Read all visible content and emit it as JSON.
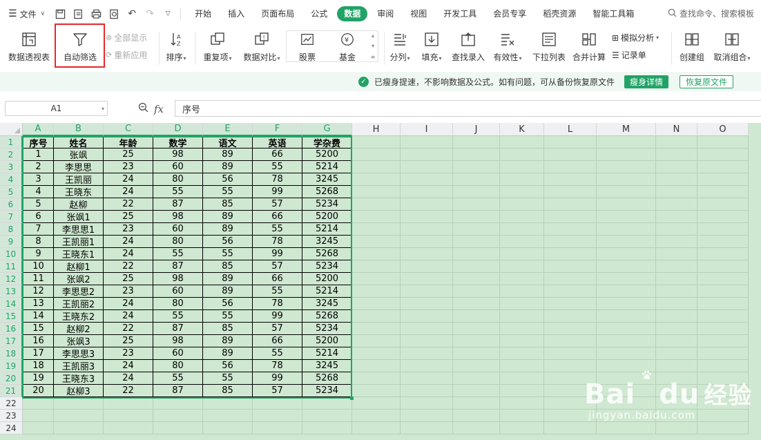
{
  "menubar": {
    "file_label": "文件",
    "tabs": [
      "开始",
      "插入",
      "页面布局",
      "公式",
      "数据",
      "审阅",
      "视图",
      "开发工具",
      "会员专享",
      "稻壳资源",
      "智能工具箱"
    ],
    "active_tab": "数据",
    "search_placeholder": "查找命令、搜索模板"
  },
  "ribbon": {
    "pivot": "数据透视表",
    "autofilter": "自动筛选",
    "show_all": "全部显示",
    "reapply": "重新应用",
    "sort": "排序",
    "duplicates": "重复项",
    "compare": "数据对比",
    "stocks": "股票",
    "funds": "基金",
    "split": "分列",
    "fill": "填充",
    "lookup_entry": "查找录入",
    "validity": "有效性",
    "dropdown_list": "下拉列表",
    "consolidate": "合并计算",
    "what_if": "模拟分析",
    "record_form": "记录单",
    "create_group": "创建组",
    "ungroup": "取消组合"
  },
  "notice": {
    "text": "已瘦身提速，不影响数据及公式。如有问题，可从备份恢复原文件",
    "details_button": "瘦身详情",
    "restore_button": "恢复原文件"
  },
  "formula_bar": {
    "cell_ref": "A1",
    "content": "序号"
  },
  "sheet": {
    "columns": [
      "A",
      "B",
      "C",
      "D",
      "E",
      "F",
      "G",
      "H",
      "I",
      "J",
      "K",
      "L",
      "M",
      "N",
      "O"
    ],
    "rows": [
      "1",
      "2",
      "3",
      "4",
      "5",
      "6",
      "7",
      "8",
      "9",
      "10",
      "11",
      "12",
      "13",
      "14",
      "15",
      "16",
      "17",
      "18",
      "19",
      "20",
      "21",
      "22",
      "23",
      "24"
    ],
    "table": [
      [
        "序号",
        "姓名",
        "年龄",
        "数学",
        "语文",
        "英语",
        "学杂费"
      ],
      [
        "1",
        "张飒",
        "25",
        "98",
        "89",
        "66",
        "5200"
      ],
      [
        "2",
        "李思思",
        "23",
        "60",
        "89",
        "55",
        "5214"
      ],
      [
        "3",
        "王凯丽",
        "24",
        "80",
        "56",
        "78",
        "3245"
      ],
      [
        "4",
        "王晓东",
        "24",
        "55",
        "55",
        "99",
        "5268"
      ],
      [
        "5",
        "赵柳",
        "22",
        "87",
        "85",
        "57",
        "5234"
      ],
      [
        "6",
        "张飒1",
        "25",
        "98",
        "89",
        "66",
        "5200"
      ],
      [
        "7",
        "李思思1",
        "23",
        "60",
        "89",
        "55",
        "5214"
      ],
      [
        "8",
        "王凯丽1",
        "24",
        "80",
        "56",
        "78",
        "3245"
      ],
      [
        "9",
        "王晓东1",
        "24",
        "55",
        "55",
        "99",
        "5268"
      ],
      [
        "10",
        "赵柳1",
        "22",
        "87",
        "85",
        "57",
        "5234"
      ],
      [
        "11",
        "张飒2",
        "25",
        "98",
        "89",
        "66",
        "5200"
      ],
      [
        "12",
        "李思思2",
        "23",
        "60",
        "89",
        "55",
        "5214"
      ],
      [
        "13",
        "王凯丽2",
        "24",
        "80",
        "56",
        "78",
        "3245"
      ],
      [
        "14",
        "王晓东2",
        "24",
        "55",
        "55",
        "99",
        "5268"
      ],
      [
        "15",
        "赵柳2",
        "22",
        "87",
        "85",
        "57",
        "5234"
      ],
      [
        "16",
        "张飒3",
        "25",
        "98",
        "89",
        "66",
        "5200"
      ],
      [
        "17",
        "李思思3",
        "23",
        "60",
        "89",
        "55",
        "5214"
      ],
      [
        "18",
        "王凯丽3",
        "24",
        "80",
        "56",
        "78",
        "3245"
      ],
      [
        "19",
        "王晓东3",
        "24",
        "55",
        "55",
        "99",
        "5268"
      ],
      [
        "20",
        "赵柳3",
        "22",
        "87",
        "85",
        "57",
        "5234"
      ]
    ]
  },
  "watermark": {
    "brand": "Bai",
    "brand_suffix": "du",
    "brand_cn": "经验",
    "url": "jingyan.baidu.com"
  },
  "colors": {
    "accent": "#21a366",
    "highlight": "#e8262b",
    "sheet_bg": "#cfe8d1"
  }
}
